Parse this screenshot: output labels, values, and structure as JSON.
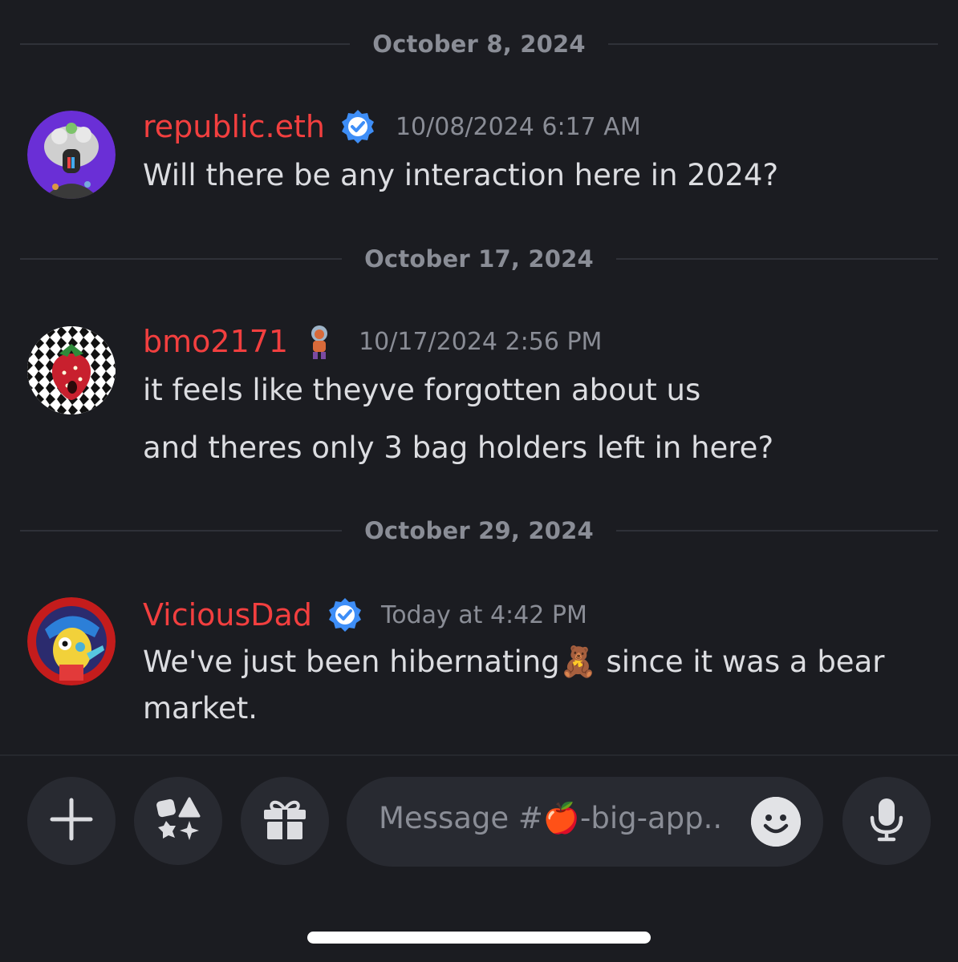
{
  "dividers": [
    "October 8, 2024",
    "October 17, 2024",
    "October 29, 2024"
  ],
  "messages": [
    {
      "username": "republic.eth",
      "timestamp": "10/08/2024 6:17 AM",
      "lines": [
        "Will there be any interaction here in 2024?"
      ],
      "badge": "verified-icon"
    },
    {
      "username": "bmo2171",
      "timestamp": "10/17/2024 2:56 PM",
      "lines": [
        "it feels like theyve forgotten about us",
        "and theres only 3 bag holders left in here?"
      ],
      "badge": "astronaut-figure-icon"
    },
    {
      "username": "ViciousDad",
      "timestamp": "Today at 4:42 PM",
      "lines": [
        "We've just been hibernating🧸 since it was a bear",
        "market."
      ],
      "badge": "verified-icon"
    }
  ],
  "composer": {
    "placeholder": "Message #🍎-big-app..",
    "buttons": [
      "plus-icon",
      "apps-icon",
      "gift-icon",
      "emoji-icon",
      "microphone-icon"
    ]
  },
  "colors": {
    "background": "#1b1c21",
    "username": "#f23f3f",
    "verified": "#3e8ef7",
    "muted": "#8a8d96"
  }
}
